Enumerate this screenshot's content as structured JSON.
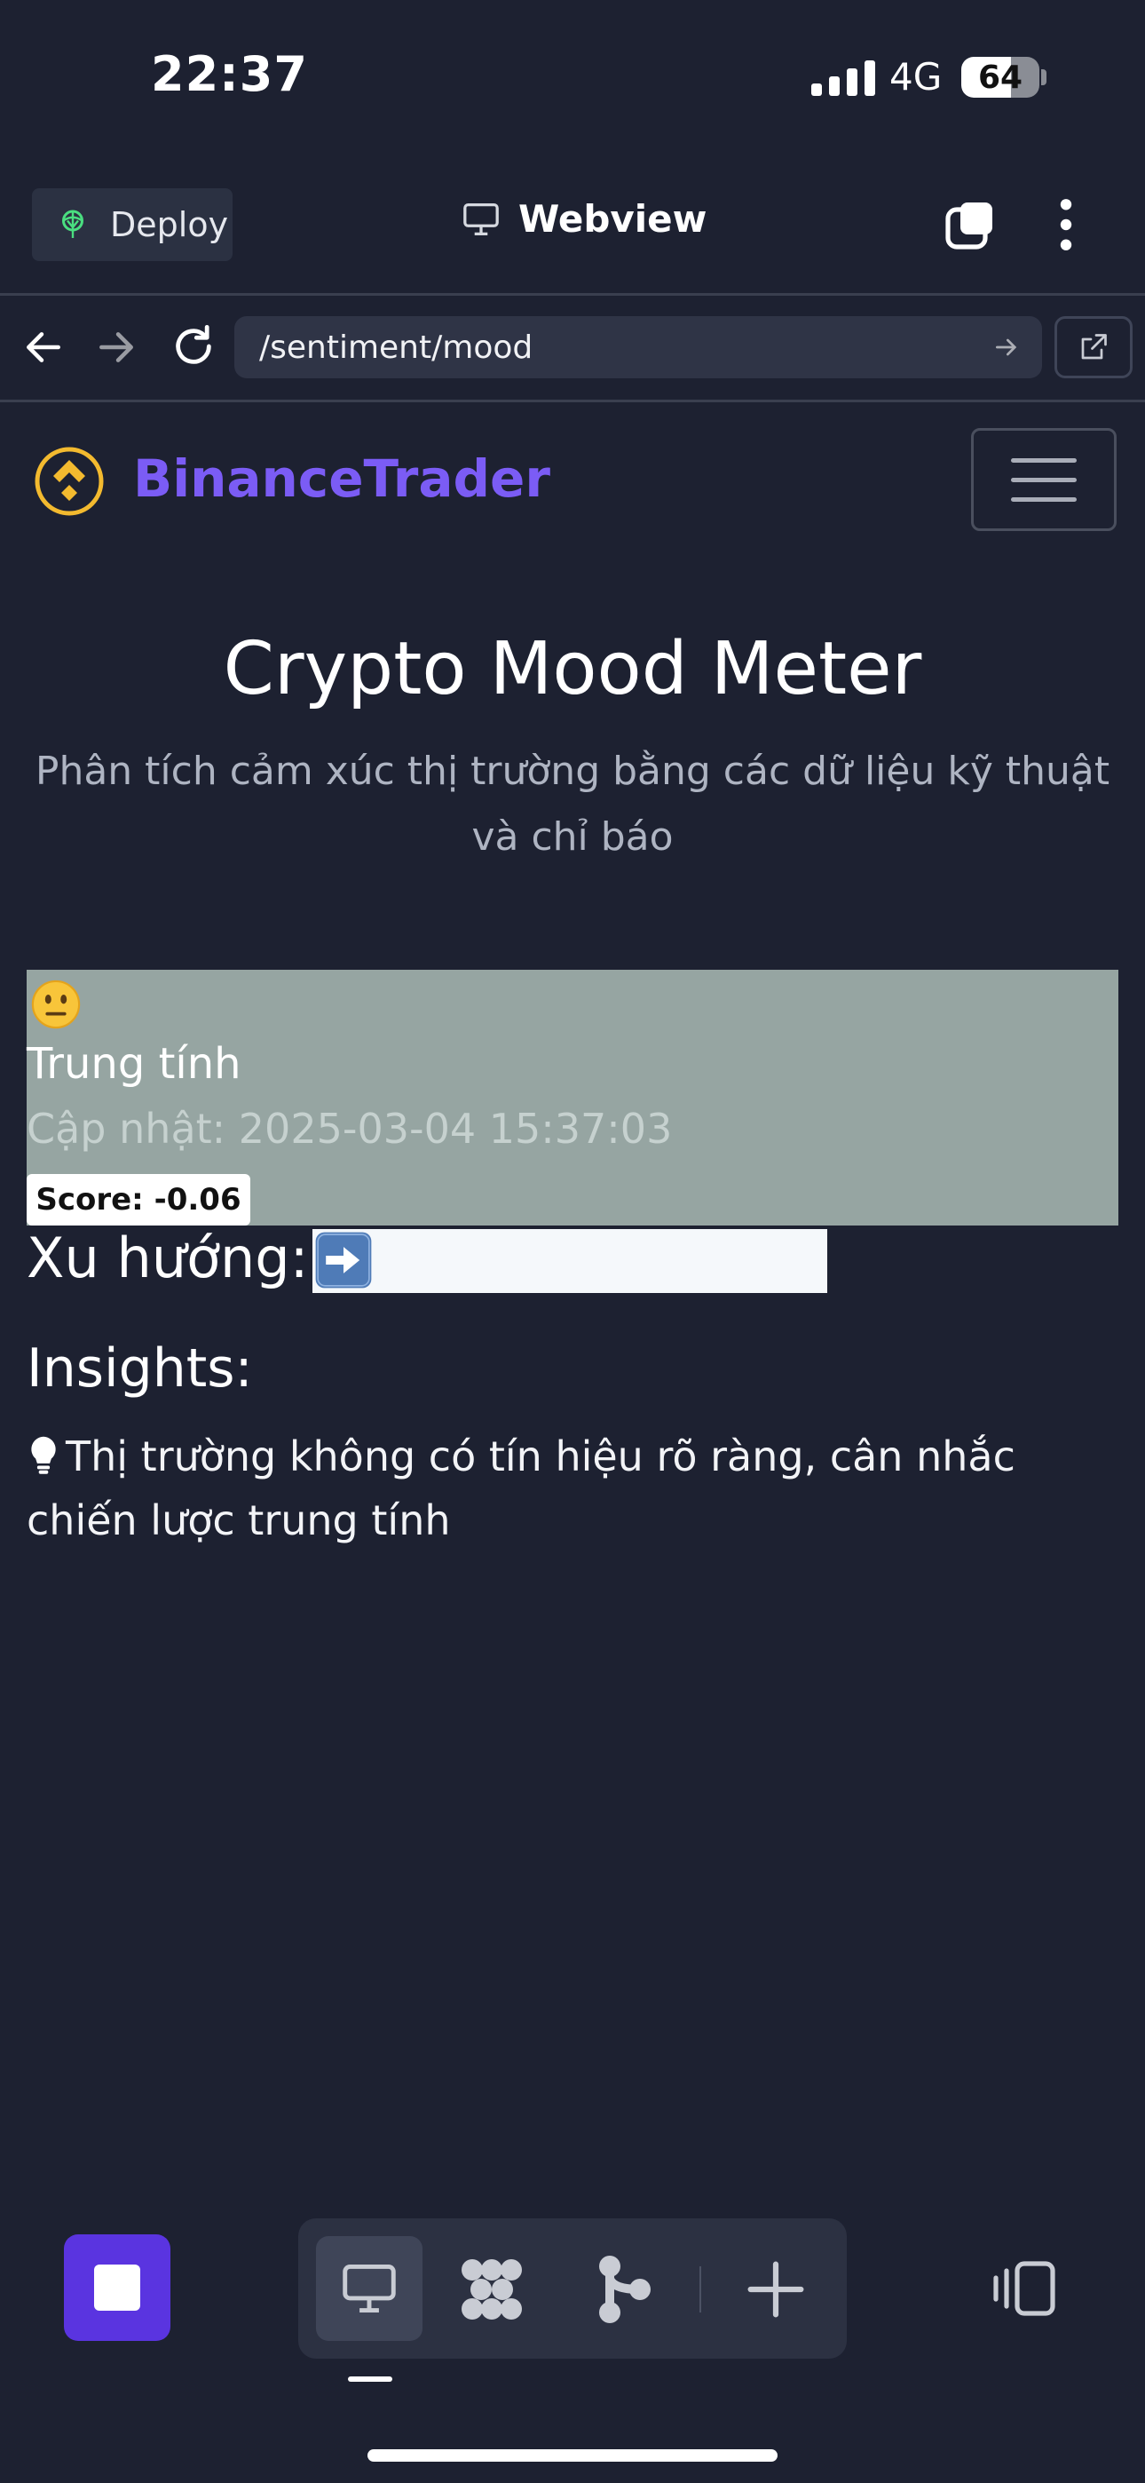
{
  "status_bar": {
    "time": "22:37",
    "network": "4G",
    "battery_percent": "64",
    "battery_level": 0.64
  },
  "toolbar": {
    "deploy_label": "Deploy",
    "webview_label": "Webview",
    "icons": [
      "deploy-icon",
      "monitor-icon",
      "tabs-icon",
      "more-vertical-icon"
    ]
  },
  "nav": {
    "url": "/sentiment/mood",
    "icons": [
      "back-arrow-icon",
      "forward-arrow-icon",
      "reload-icon",
      "go-arrow-icon",
      "external-link-icon"
    ]
  },
  "app": {
    "brand": "BinanceTrader",
    "brand_color": "#7b5cf5",
    "logo_color": "#f3ba2f"
  },
  "main": {
    "title": "Crypto Mood Meter",
    "subtitle": "Phân tích cảm xúc thị trường bằng các dữ liệu kỹ thuật và chỉ báo",
    "mood": {
      "emoji": "neutral-face-icon",
      "label": "Trung tính",
      "updated": "Cập nhật: 2025-03-04 15:37:03",
      "score": "Score: -0.06",
      "card_color": "#96a5a2"
    },
    "trend": {
      "label": "Xu hướng:",
      "arrow_icon": "right-arrow-icon"
    },
    "insights": {
      "title": "Insights:",
      "items": [
        "Thị trường không có tín hiệu rõ ràng, cân nhắc chiến lược trung tính"
      ]
    }
  },
  "dock": {
    "items": [
      "stop-icon",
      "desktop-icon",
      "nodes-icon",
      "branch-icon",
      "add-icon",
      "panel-icon"
    ],
    "accent": "#5a34e0"
  }
}
